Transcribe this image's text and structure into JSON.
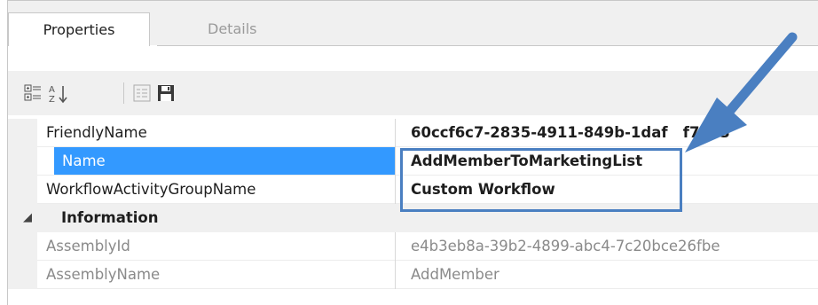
{
  "tabs": [
    {
      "label": "Properties",
      "active": true
    },
    {
      "label": "Details",
      "active": false
    }
  ],
  "toolbar": {
    "icons": [
      "categorized-view-icon",
      "alphabetical-sort-icon",
      "property-pages-icon",
      "save-icon"
    ]
  },
  "properties": [
    {
      "key": "FriendlyName",
      "value": "60ccf6c7-2835-4911-849b-1daf   f7373",
      "bold": true,
      "selected": false
    },
    {
      "key": "Name",
      "value": "AddMemberToMarketingList",
      "bold": true,
      "selected": true
    },
    {
      "key": "WorkflowActivityGroupName",
      "value": "Custom Workflow",
      "bold": true,
      "selected": false
    }
  ],
  "category": {
    "label": "Information",
    "expanded": true
  },
  "info_properties": [
    {
      "key": "AssemblyId",
      "value": "e4b3eb8a-39b2-4899-abc4-7c20bce26fbe"
    },
    {
      "key": "AssemblyName",
      "value": "AddMember"
    }
  ],
  "colors": {
    "selection": "#3399ff",
    "callout": "#4a7fc1",
    "panel": "#f0f0f0"
  }
}
